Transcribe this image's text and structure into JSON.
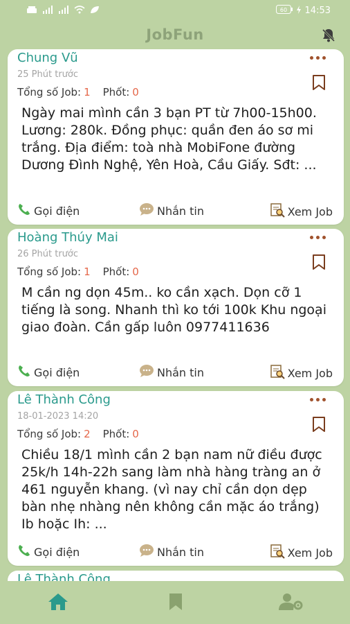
{
  "statusbar": {
    "time": "14:53",
    "battery": "60"
  },
  "app": {
    "title": "JobFun"
  },
  "labels": {
    "total_jobs": "Tổng số Job:",
    "fines": "Phốt:"
  },
  "actions": {
    "call": "Gọi điện",
    "message": "Nhắn tin",
    "view_job": "Xem Job"
  },
  "posts": [
    {
      "name": "Chung Vũ",
      "time": "25 Phút trước",
      "jobs": "1",
      "fines": "0",
      "content": "Ngày mai mình cần 3 bạn PT từ 7h00-15h00. Lương: 280k. Đồng phục: quần đen áo sơ mi trắng. Địa điểm: toà nhà MobiFone đường Dương Đình Nghệ, Yên Hoà, Cầu Giấy. Sđt: ..."
    },
    {
      "name": "Hoàng Thúy Mai",
      "time": "26 Phút trước",
      "jobs": "1",
      "fines": "0",
      "content": "M cần ng dọn 45m.. ko cần xạch. Dọn cỡ 1 tiếng là song. Nhanh thì ko tới 100k Khu ngoại giao đoàn. Cần gấp luôn 0977411636"
    },
    {
      "name": "Lê Thành Công",
      "time": "18-01-2023 14:20",
      "jobs": "2",
      "fines": "0",
      "content": "Chiều 18/1 mình cần 2 bạn nam nữ điều được 25k/h 14h-22h sang làm nhà hàng tràng an ở 461 nguyễn khang. (vì nay chỉ cần dọn dẹp bàn nhẹ nhàng nên không cần mặc áo trắng) Ib hoặc Ih: ..."
    },
    {
      "name": "Lê Thành Công"
    }
  ],
  "colors": {
    "accent": "#2a9a8c",
    "count": "#e5674a",
    "background": "#bdd3a3",
    "icon": "#8aa26f"
  }
}
